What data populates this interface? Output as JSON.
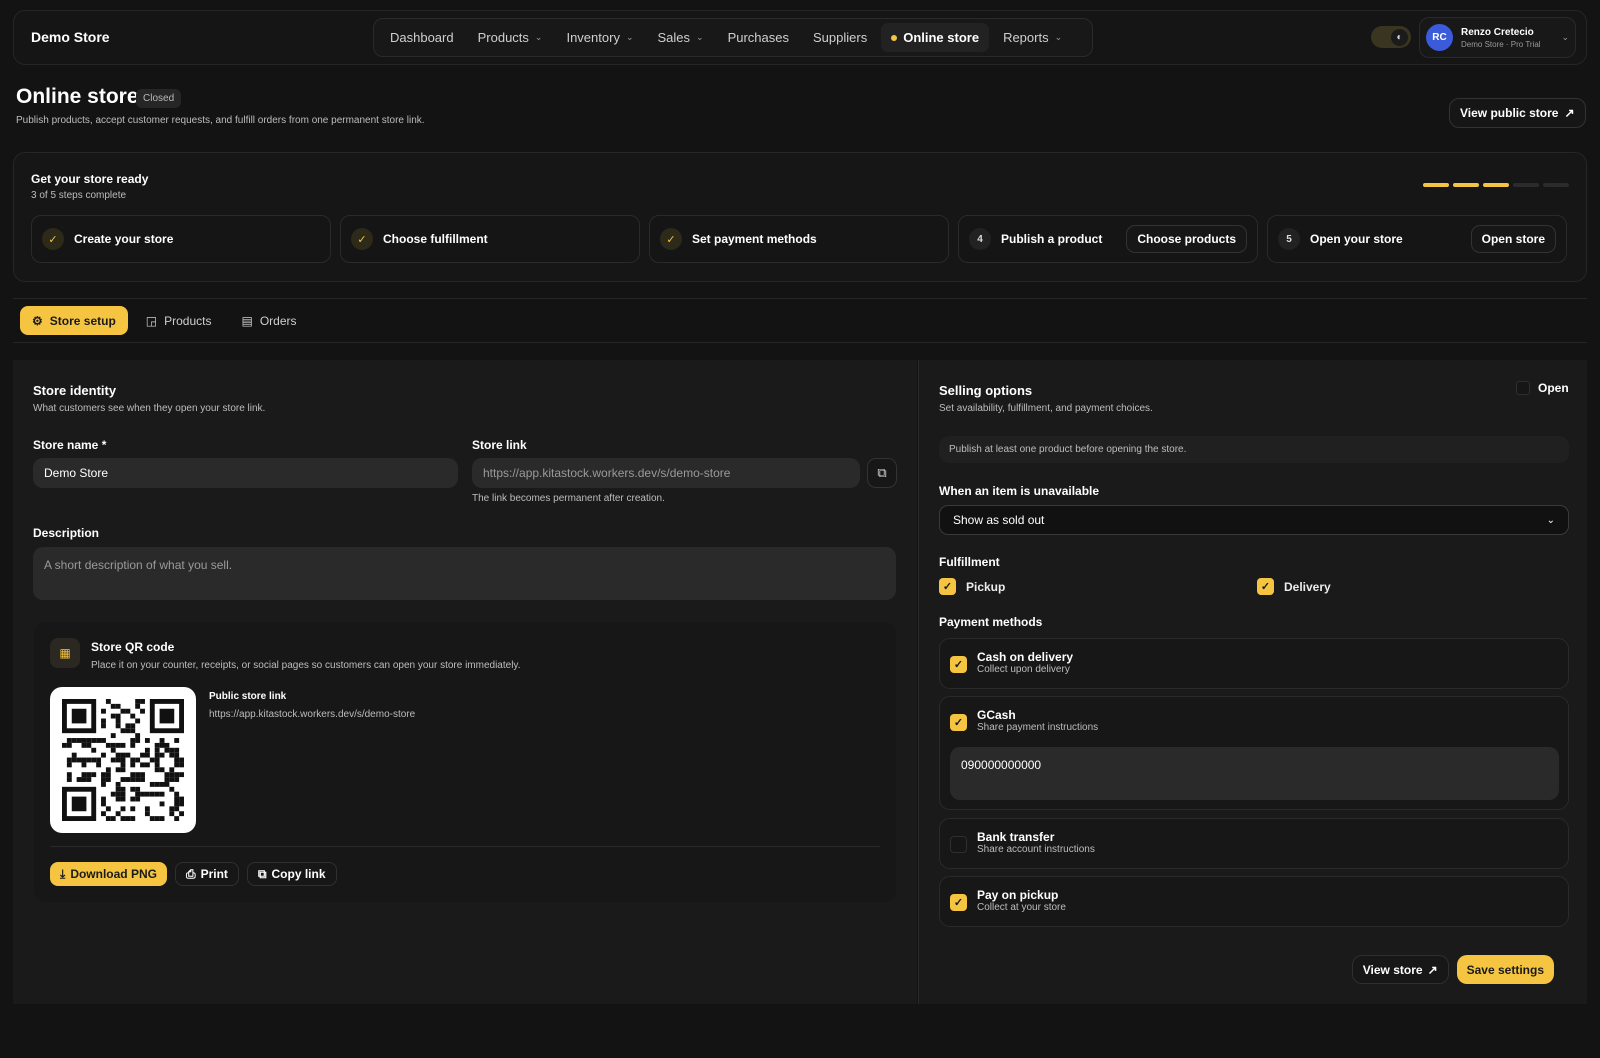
{
  "app": {
    "brand": "Demo Store",
    "nav": [
      {
        "label": "Dashboard",
        "has_menu": false,
        "active": false
      },
      {
        "label": "Products",
        "has_menu": true,
        "active": false
      },
      {
        "label": "Inventory",
        "has_menu": true,
        "active": false
      },
      {
        "label": "Sales",
        "has_menu": true,
        "active": false
      },
      {
        "label": "Purchases",
        "has_menu": false,
        "active": false
      },
      {
        "label": "Suppliers",
        "has_menu": false,
        "active": false
      },
      {
        "label": "Online store",
        "has_menu": false,
        "active": true
      },
      {
        "label": "Reports",
        "has_menu": true,
        "active": false
      }
    ],
    "theme_toggle_icon": "moon-icon",
    "user": {
      "initials": "RC",
      "name": "Renzo Cretecio",
      "subtitle": "Demo Store · Pro Trial"
    }
  },
  "header": {
    "title": "Online store",
    "status_badge": "Closed",
    "subtitle": "Publish products, accept customer requests, and fulfill orders from one permanent store link.",
    "view_public_label": "View public store"
  },
  "setup": {
    "title": "Get your store ready",
    "progress_text": "3 of 5 steps complete",
    "steps_total": 5,
    "steps_done": 3,
    "steps": [
      {
        "label": "Create your store",
        "done": true,
        "number": "1",
        "action": ""
      },
      {
        "label": "Choose fulfillment",
        "done": true,
        "number": "2",
        "action": ""
      },
      {
        "label": "Set payment methods",
        "done": true,
        "number": "3",
        "action": ""
      },
      {
        "label": "Publish a product",
        "done": false,
        "number": "4",
        "action": "Choose products"
      },
      {
        "label": "Open your store",
        "done": false,
        "number": "5",
        "action": "Open store"
      }
    ]
  },
  "tabs": [
    {
      "label": "Store setup",
      "icon": "sliders-icon",
      "active": true
    },
    {
      "label": "Products",
      "icon": "box-icon",
      "active": false
    },
    {
      "label": "Orders",
      "icon": "clipboard-icon",
      "active": false
    }
  ],
  "identity": {
    "title": "Store identity",
    "subtitle": "What customers see when they open your store link.",
    "name_label": "Store name *",
    "name_value": "Demo Store",
    "link_label": "Store link",
    "link_value": "https://app.kitastock.workers.dev/s/demo-store",
    "link_hint": "The link becomes permanent after creation.",
    "description_label": "Description",
    "description_placeholder": "A short description of what you sell."
  },
  "qr": {
    "title": "Store QR code",
    "subtitle": "Place it on your counter, receipts, or social pages so customers can open your store immediately.",
    "link_label": "Public store link",
    "link_value": "https://app.kitastock.workers.dev/s/demo-store",
    "download_label": "Download PNG",
    "print_label": "Print",
    "copy_label": "Copy link"
  },
  "selling": {
    "title": "Selling options",
    "subtitle": "Set availability, fulfillment, and payment choices.",
    "open_label": "Open",
    "open_checked": false,
    "notice": "Publish at least one product before opening the store.",
    "unavailable_label": "When an item is unavailable",
    "unavailable_value": "Show as sold out",
    "fulfillment_label": "Fulfillment",
    "fulfillment": [
      {
        "label": "Pickup",
        "checked": true
      },
      {
        "label": "Delivery",
        "checked": true
      }
    ],
    "payment_label": "Payment methods",
    "payments": [
      {
        "title": "Cash on delivery",
        "subtitle": "Collect upon delivery",
        "checked": true
      },
      {
        "title": "GCash",
        "subtitle": "Share payment instructions",
        "checked": true,
        "instructions": "090000000000"
      },
      {
        "title": "Bank transfer",
        "subtitle": "Share account instructions",
        "checked": false
      },
      {
        "title": "Pay on pickup",
        "subtitle": "Collect at your store",
        "checked": true
      }
    ],
    "view_store_label": "View store",
    "save_label": "Save settings"
  },
  "colors": {
    "accent": "#f5c542",
    "background": "#131313",
    "avatar": "#3b5bdb"
  }
}
